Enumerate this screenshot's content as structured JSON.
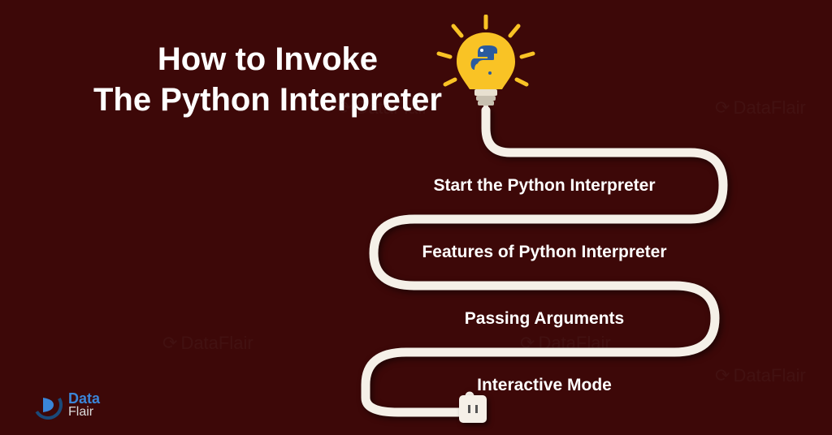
{
  "title_line1": "How to Invoke",
  "title_line2": "The Python Interpreter",
  "items": [
    "Start the Python Interpreter",
    "Features of Python Interpreter",
    "Passing Arguments",
    "Interactive Mode"
  ],
  "logo": {
    "line1": "Data",
    "line2": "Flair"
  },
  "watermark": "DataFlair",
  "colors": {
    "background": "#3d0808",
    "wire": "#f5f0e8",
    "bulb_glass": "#f9c325",
    "bulb_rays": "#f9c325",
    "python_blue": "#2b5b9e",
    "python_yellow": "#f9c325"
  }
}
